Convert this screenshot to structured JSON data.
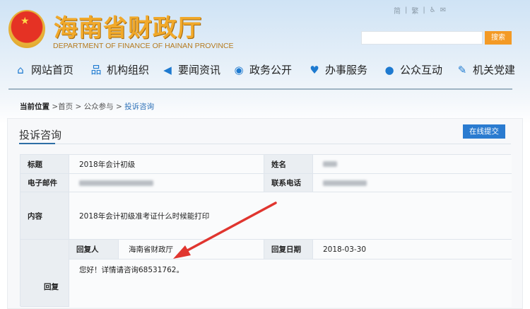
{
  "header": {
    "site_title": "海南省财政厅",
    "site_subtitle": "DEPARTMENT OF FINANCE OF HAINAN PROVINCE",
    "top_links": {
      "simplified": "简",
      "traditional": "繁",
      "separator": "|"
    },
    "search": {
      "placeholder": "",
      "button": "搜索"
    }
  },
  "nav": [
    {
      "label": "网站首页",
      "icon": "home-icon"
    },
    {
      "label": "机构组织",
      "icon": "org-chart-icon"
    },
    {
      "label": "要闻资讯",
      "icon": "megaphone-icon"
    },
    {
      "label": "政务公开",
      "icon": "eye-icon"
    },
    {
      "label": "办事服务",
      "icon": "heart-icon"
    },
    {
      "label": "公众互动",
      "icon": "chat-icon"
    },
    {
      "label": "机关党建",
      "icon": "pen-icon"
    }
  ],
  "breadcrumb": {
    "label": "当前位置",
    "sep": ">",
    "items": [
      "首页",
      "公众参与",
      "投诉咨询"
    ]
  },
  "panel": {
    "title": "投诉咨询",
    "submit_button": "在线提交"
  },
  "detail": {
    "title_label": "标题",
    "title_value": "2018年会计初级",
    "name_label": "姓名",
    "email_label": "电子邮件",
    "phone_label": "联系电话",
    "content_label": "内容",
    "content_value": "2018年会计初级准考证什么时候能打印",
    "reply_label": "回复",
    "replier_label": "回复人",
    "replier_value": "海南省财政厅",
    "reply_date_label": "回复日期",
    "reply_date_value": "2018-03-30",
    "reply_text": "您好！详情请咨询68531762。"
  },
  "colors": {
    "accent": "#2a7bd0",
    "search_button": "#f39a26",
    "annotation_arrow": "#e0352f"
  }
}
